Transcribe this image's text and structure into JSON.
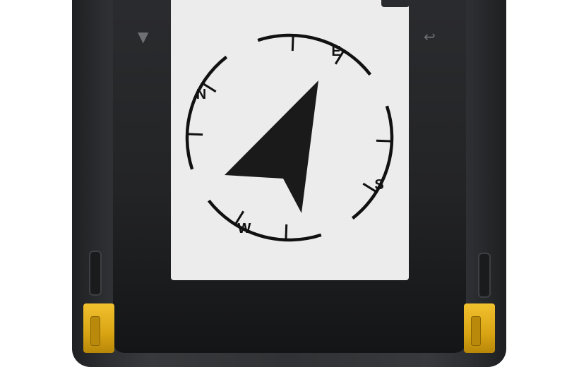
{
  "device": {
    "accent_color": "#e3b01f",
    "body_color": "#303235",
    "screen_color": "#ececec"
  },
  "keys": {
    "left_icon": "▼",
    "right_icon": "↩"
  },
  "compass": {
    "cardinal_labels": {
      "north": "N",
      "east": "E",
      "south": "S",
      "west": "W"
    },
    "icons": [
      "down-arrow-icon",
      "back-icon",
      "compass-dial-icon",
      "navigation-arrow-icon"
    ]
  }
}
